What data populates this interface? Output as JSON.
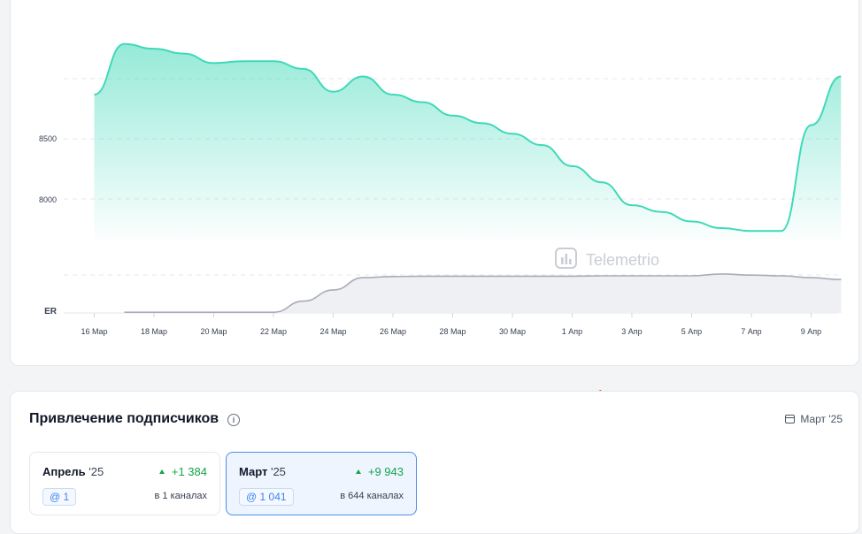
{
  "chart": {
    "watermark": "Telemetrio",
    "y_labels": [
      "8500",
      "8000"
    ],
    "er_label": "ER",
    "x_labels": [
      "16 Мар",
      "18 Мар",
      "20 Мар",
      "22 Мар",
      "24 Мар",
      "26 Мар",
      "28 Мар",
      "30 Мар",
      "1 Апр",
      "3 Апр",
      "5 Апр",
      "7 Апр",
      "9 Апр"
    ],
    "accent": "#3fd9b9",
    "er_color": "#a9acb6"
  },
  "chart_data": {
    "type": "area",
    "x": [
      "16 Мар",
      "17 Мар",
      "18 Мар",
      "19 Мар",
      "20 Мар",
      "21 Мар",
      "22 Мар",
      "23 Мар",
      "24 Мар",
      "25 Мар",
      "26 Мар",
      "27 Мар",
      "28 Мар",
      "29 Мар",
      "30 Мар",
      "31 Мар",
      "1 Апр",
      "2 Апр",
      "3 Апр",
      "4 Апр",
      "5 Апр",
      "6 Апр",
      "7 Апр",
      "8 Апр",
      "9 Апр",
      "10 Апр"
    ],
    "series": [
      {
        "values": [
          8870,
          9400,
          9350,
          9300,
          9200,
          9220,
          9220,
          9140,
          8900,
          9060,
          8870,
          8790,
          8650,
          8570,
          8460,
          8340,
          8120,
          7950,
          7710,
          7640,
          7540,
          7470,
          7440,
          7440,
          8550,
          9060
        ]
      },
      {
        "values": [
          0.02,
          0.02,
          0.02,
          0.02,
          0.02,
          0.02,
          0.32,
          0.62,
          0.95,
          0.98,
          0.99,
          0.99,
          0.99,
          0.99,
          0.99,
          0.99,
          1.0,
          1.0,
          1.0,
          1.0,
          1.05,
          1.02,
          1.0,
          0.95,
          0.9
        ]
      }
    ],
    "yticks": [
      8000,
      8500
    ],
    "ylim": [
      7350,
      9500
    ],
    "grid": true
  },
  "subscribers": {
    "title": "Привлечение подписчиков",
    "info_icon": "i",
    "period": "Март '25",
    "cards": [
      {
        "month": "Апрель",
        "year": " '25",
        "delta": "+1 384",
        "count": "@ 1",
        "channels": "в 1 каналах"
      },
      {
        "month": "Март",
        "year": " '25",
        "delta": "+9 943",
        "count": "@ 1 041",
        "channels": "в 644 каналах"
      }
    ]
  },
  "annotation": {
    "arrow_color": "#e11d1d"
  }
}
